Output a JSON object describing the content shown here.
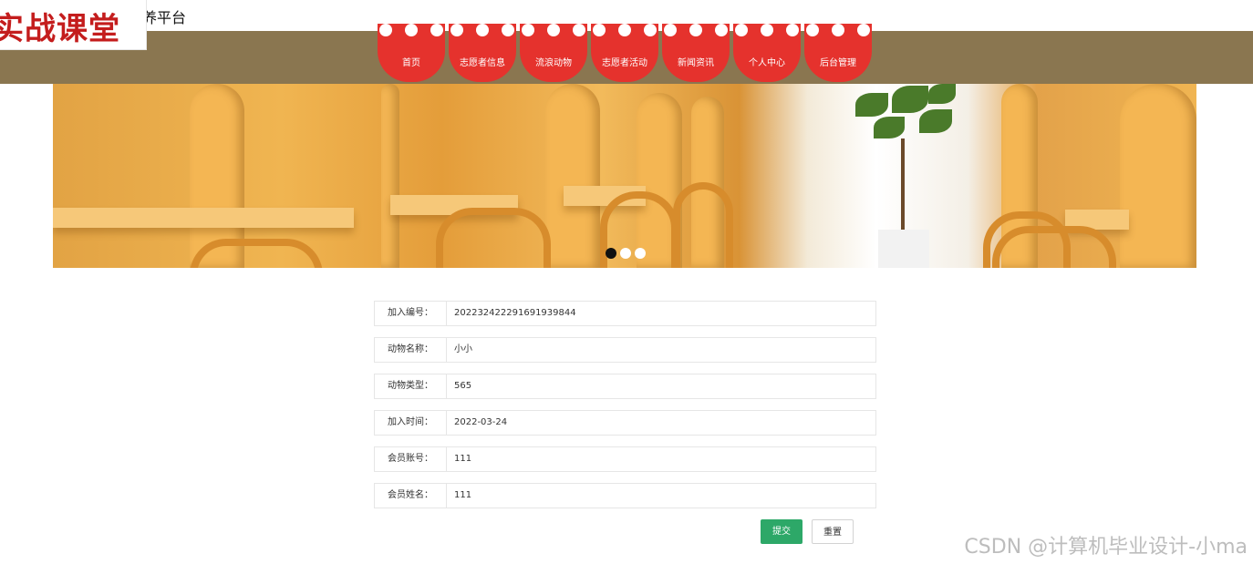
{
  "header": {
    "brand": "实战课堂",
    "site_title": "顿养平台"
  },
  "nav": [
    {
      "label": "首页"
    },
    {
      "label": "志愿者信息"
    },
    {
      "label": "流浪动物"
    },
    {
      "label": "志愿者活动"
    },
    {
      "label": "新闻资讯"
    },
    {
      "label": "个人中心"
    },
    {
      "label": "后台管理"
    }
  ],
  "banner": {
    "slide_count": 3,
    "active_slide": 1
  },
  "form": {
    "fields": [
      {
        "label": "加入编号：",
        "value": "202232422291691939844"
      },
      {
        "label": "动物名称：",
        "value": "小小"
      },
      {
        "label": "动物类型：",
        "value": "565"
      },
      {
        "label": "加入时间：",
        "value": "2022-03-24"
      },
      {
        "label": "会员账号：",
        "value": "111"
      },
      {
        "label": "会员姓名：",
        "value": "111"
      }
    ],
    "submit_label": "提交",
    "reset_label": "重置"
  },
  "watermark": "CSDN @计算机毕业设计-小ma",
  "colors": {
    "nav_bar": "#8a7650",
    "nav_item": "#e5322d",
    "submit": "#2da868",
    "brand": "#c41d1d"
  }
}
